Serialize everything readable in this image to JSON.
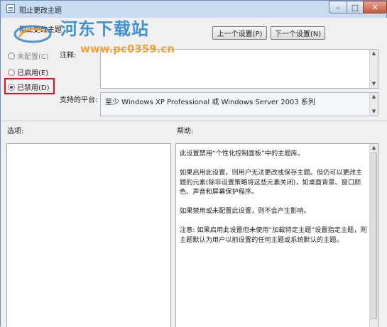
{
  "window": {
    "title": "阻止更改主题",
    "subtitle": "阻止更改主题",
    "controls": {
      "minimize": "–",
      "maximize": "□",
      "close": "✕"
    }
  },
  "nav": {
    "prev_label": "上一个设置(P)",
    "next_label": "下一个设置(N)"
  },
  "state": {
    "options": [
      {
        "label": "未配置(C)",
        "checked": false
      },
      {
        "label": "已启用(E)",
        "checked": false
      },
      {
        "label": "已禁用(D)",
        "checked": true
      }
    ]
  },
  "comment": {
    "label": "注释:",
    "value": ""
  },
  "platform": {
    "label": "支持的平台:",
    "value": "至少 Windows XP Professional 或 Windows Server 2003 系列"
  },
  "options_pane": {
    "label": "选项:"
  },
  "help_pane": {
    "label": "帮助:",
    "paragraphs": [
      "此设置禁用“个性化控制面板”中的主题库。",
      "如果启用此设置，则用户无法更改或保存主题。但仍可以更改主题的元素(除非设置策略将这些元素关闭)，如桌面背景、窗口颜色、声音和屏幕保护程序。",
      "如果禁用或未配置此设置，则不会产生影响。",
      "注意: 如果启用此设置但未使用“加载特定主题”设置指定主题，则主题默认为用户以前设置的任何主题或系统默认的主题。"
    ]
  },
  "watermark": {
    "site_name": "河东下载站",
    "url": "www.pc0359.cn"
  },
  "colors": {
    "accent_highlight": "#e2131a",
    "watermark_blue": "#2f86cf",
    "watermark_orange": "#f19a21"
  }
}
